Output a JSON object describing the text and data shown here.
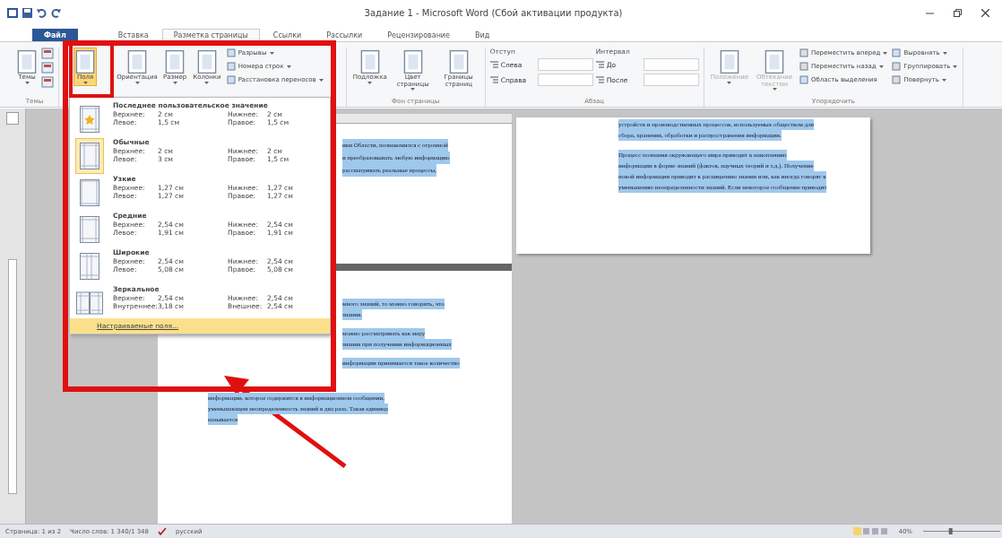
{
  "window": {
    "title": "Задание 1 - Microsoft Word (Сбой активации продукта)"
  },
  "tabs": [
    {
      "label": "Файл",
      "kind": "file",
      "selected": false
    },
    {
      "label": "Вставка",
      "kind": "tab",
      "selected": false
    },
    {
      "label": "Разметка страницы",
      "kind": "tab",
      "selected": true
    },
    {
      "label": "Ссылки",
      "kind": "tab",
      "selected": false
    },
    {
      "label": "Рассылки",
      "kind": "tab",
      "selected": false
    },
    {
      "label": "Рецензирование",
      "kind": "tab",
      "selected": false
    },
    {
      "label": "Вид",
      "kind": "tab",
      "selected": false
    }
  ],
  "ribbon": {
    "groups": [
      {
        "label": "Темы",
        "columns": [
          [
            {
              "kind": "large",
              "label": "Темы",
              "dropdown": true,
              "selected": false,
              "disabled": false
            }
          ],
          [
            {
              "kind": "icon",
              "disabled": false
            },
            {
              "kind": "icon",
              "disabled": false
            },
            {
              "kind": "icon",
              "disabled": false
            }
          ]
        ]
      },
      {
        "columns": [
          [
            {
              "kind": "large",
              "label": "Поля",
              "dropdown": true,
              "selected": true,
              "disabled": false
            }
          ],
          [
            {
              "kind": "large",
              "label": "Ориентация",
              "dropdown": true,
              "selected": false,
              "disabled": false
            }
          ],
          [
            {
              "kind": "large",
              "label": "Размер",
              "dropdown": true,
              "selected": false,
              "disabled": false
            }
          ],
          [
            {
              "kind": "large",
              "label": "Колонки",
              "dropdown": true,
              "selected": false,
              "disabled": false
            }
          ],
          [
            {
              "kind": "small",
              "label": "Разрывы",
              "dropdown": true,
              "disabled": false
            },
            {
              "kind": "small",
              "label": "Номера строк",
              "dropdown": true,
              "disabled": false
            },
            {
              "kind": "small",
              "label": "Расстановка переносов",
              "dropdown": true,
              "disabled": false
            }
          ]
        ]
      },
      {
        "label": "Фон страницы",
        "columns": [
          [
            {
              "kind": "large",
              "label": "Подложка",
              "dropdown": true,
              "selected": false,
              "disabled": false
            }
          ],
          [
            {
              "kind": "large",
              "label": "Цвет страницы",
              "dropdown": true,
              "selected": false,
              "disabled": false
            }
          ],
          [
            {
              "kind": "large",
              "label": "Границы страниц",
              "dropdown": false,
              "selected": false,
              "disabled": false
            }
          ]
        ]
      },
      {
        "label": "Абзац",
        "columns": [
          [
            {
              "kind": "heading",
              "label": "Отступ"
            },
            {
              "kind": "spin",
              "label": "Слева"
            },
            {
              "kind": "spin",
              "label": "Справа"
            }
          ],
          [
            {
              "kind": "heading",
              "label": "Интервал"
            },
            {
              "kind": "spin",
              "label": "До"
            },
            {
              "kind": "spin",
              "label": "После"
            }
          ]
        ]
      },
      {
        "label": "Упорядочить",
        "columns": [
          [
            {
              "kind": "large",
              "label": "Положение",
              "dropdown": true,
              "selected": false,
              "disabled": true
            }
          ],
          [
            {
              "kind": "large",
              "label": "Обтекание текстом",
              "dropdown": true,
              "selected": false,
              "disabled": true
            }
          ],
          [
            {
              "kind": "small",
              "label": "Переместить вперед",
              "dropdown": true,
              "disabled": true
            },
            {
              "kind": "small",
              "label": "Переместить назад",
              "dropdown": true,
              "disabled": true
            },
            {
              "kind": "small",
              "label": "Область выделения",
              "dropdown": false,
              "disabled": false
            }
          ],
          [
            {
              "kind": "small",
              "label": "Выровнять",
              "dropdown": true,
              "disabled": false
            },
            {
              "kind": "small",
              "label": "Группировать",
              "dropdown": true,
              "disabled": true
            },
            {
              "kind": "small",
              "label": "Повернуть",
              "dropdown": true,
              "disabled": true
            }
          ]
        ]
      }
    ]
  },
  "margins_menu": {
    "items": [
      {
        "title": "Последнее пользовательское значение",
        "kind": "star",
        "selected": false,
        "rows": [
          [
            "Верхнее:",
            "2 см",
            "Нижнее:",
            "2 см"
          ],
          [
            "Левое:",
            "1,5 см",
            "Правое:",
            "1,5 см"
          ]
        ]
      },
      {
        "title": "Обычные",
        "kind": "normal",
        "selected": true,
        "rows": [
          [
            "Верхнее:",
            "2 см",
            "Нижнее:",
            "2 см"
          ],
          [
            "Левое:",
            "3 см",
            "Правое:",
            "1,5 см"
          ]
        ]
      },
      {
        "title": "Узкие",
        "kind": "narrow",
        "selected": false,
        "rows": [
          [
            "Верхнее:",
            "1,27 см",
            "Нижнее:",
            "1,27 см"
          ],
          [
            "Левое:",
            "1,27 см",
            "Правое:",
            "1,27 см"
          ]
        ]
      },
      {
        "title": "Средние",
        "kind": "moderate",
        "selected": false,
        "rows": [
          [
            "Верхнее:",
            "2,54 см",
            "Нижнее:",
            "2,54 см"
          ],
          [
            "Левое:",
            "1,91 см",
            "Правое:",
            "1,91 см"
          ]
        ]
      },
      {
        "title": "Широкие",
        "kind": "wide",
        "selected": false,
        "rows": [
          [
            "Верхнее:",
            "2,54 см",
            "Нижнее:",
            "2,54 см"
          ],
          [
            "Левое:",
            "5,08 см",
            "Правое:",
            "5,08 см"
          ]
        ]
      },
      {
        "title": "Зеркальное",
        "kind": "mirrored",
        "selected": false,
        "rows": [
          [
            "Верхнее:",
            "2,54 см",
            "Нижнее:",
            "2,54 см"
          ],
          [
            "Внутреннее:",
            "3,18 см",
            "Внешнее:",
            "2,54 см"
          ]
        ]
      }
    ],
    "footer": {
      "label": "Настраиваемые поля...",
      "highlighted": true
    }
  },
  "document": {
    "pages": [
      {
        "kind": "left-top",
        "paragraphs": [
          {
            "clipped": true,
            "lines": [
              "ики Области, познакомился с огромной",
              "и преобразовывать любую информацию",
              "рассматривать реальные процессы,"
            ]
          }
        ]
      },
      {
        "kind": "left-bottom",
        "paragraphs": [
          {
            "clipped": true,
            "lines": [
              "много знаний, то можно говорить, что",
              "знания."
            ]
          },
          {
            "clipped": true,
            "lines": [
              "можно рассматривать как меру",
              "знания при получении информационных"
            ]
          },
          {
            "clipped": true,
            "lines": [
              "информации принимается такое количество"
            ]
          },
          {
            "clipped": false,
            "lines": [
              "информации, которое содержится в информационном сообщении,",
              "уменьшающем неопределенность знаний в два раза. Такая единица",
              "называется"
            ]
          }
        ]
      },
      {
        "kind": "right-top",
        "paragraphs": [
          {
            "clipped": false,
            "lines": [
              "устройств и производственных процессов, используемых обществом для",
              "сбора, хранения, обработки и распространения информации."
            ]
          },
          {
            "clipped": false,
            "lines": [
              "Процесс познания окружающего мира приводит к накоплению",
              "информации в форме знаний (фактов, научных теорий и т.д.). Получение",
              "новой информации приводит к расширению знания или, как иногда говорят к",
              "уменьшению неопределенности знаний. Если некоторое сообщение приводит"
            ]
          }
        ]
      }
    ]
  },
  "status_bar": {
    "page": "Страница: 1 из 2",
    "words": "Число слов: 1 340/1 348",
    "language": "русский",
    "zoom": "40%",
    "zoom_slider": {
      "level": 0.35
    }
  }
}
